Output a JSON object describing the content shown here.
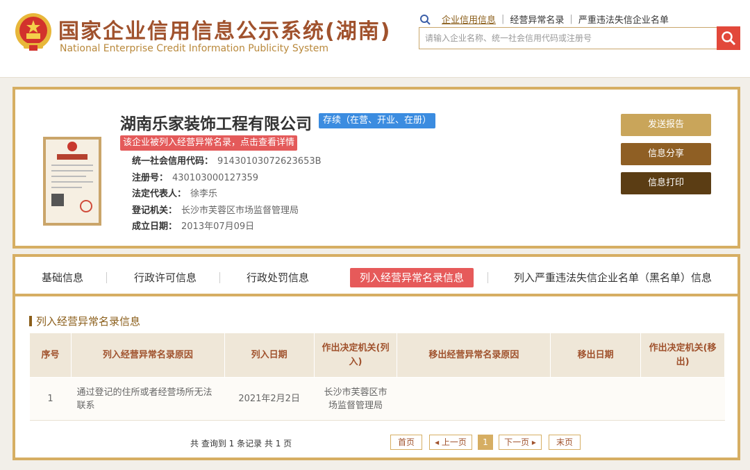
{
  "header": {
    "title_cn": "国家企业信用信息公示系统(湖南)",
    "title_en": "National Enterprise Credit Information Publicity System",
    "search_tabs": [
      "企业信用信息",
      "经营异常名录",
      "严重违法失信企业名单"
    ],
    "search_placeholder": "请输入企业名称、统一社会信用代码或注册号",
    "emblem_icon": "national-emblem-icon",
    "search_icon": "search-icon"
  },
  "company": {
    "name": "湖南乐家装饰工程有限公司",
    "status": "存续（在营、开业、在册）",
    "abnormal_notice": "该企业被列入经营异常名录，点击查看详情",
    "fields": [
      {
        "label": "统一社会信用代码：",
        "value": "91430103072623653B"
      },
      {
        "label": "注册号：",
        "value": "430103000127359"
      },
      {
        "label": "法定代表人：",
        "value": "徐李乐"
      },
      {
        "label": "登记机关：",
        "value": "长沙市芙蓉区市场监督管理局"
      },
      {
        "label": "成立日期：",
        "value": "2013年07月09日"
      }
    ],
    "license_image": "business-license-icon",
    "actions": {
      "send": "发送报告",
      "share": "信息分享",
      "print": "信息打印"
    }
  },
  "tabs": [
    {
      "label": "基础信息",
      "active": false
    },
    {
      "label": "行政许可信息",
      "active": false
    },
    {
      "label": "行政处罚信息",
      "active": false
    },
    {
      "label": "列入经营异常名录信息",
      "active": true
    },
    {
      "label": "列入严重违法失信企业名单（黑名单）信息",
      "active": false
    }
  ],
  "section": {
    "title": "列入经营异常名录信息",
    "columns": [
      "序号",
      "列入经营异常名录原因",
      "列入日期",
      "作出决定机关(列入)",
      "移出经营异常名录原因",
      "移出日期",
      "作出决定机关(移出)"
    ],
    "rows": [
      [
        "1",
        "通过登记的住所或者经营场所无法联系",
        "2021年2月2日",
        "长沙市芙蓉区市场监督管理局",
        "",
        "",
        ""
      ]
    ],
    "total": "共 查询到 1 条记录 共 1 页",
    "pager": {
      "first": "首页",
      "prev": "上一页",
      "current": "1",
      "next": "下一页",
      "last": "末页"
    }
  },
  "colors": {
    "gold": "#d6ae63",
    "brown": "#a0522d",
    "red": "#e65a5a",
    "blue": "#3b8ce0"
  }
}
